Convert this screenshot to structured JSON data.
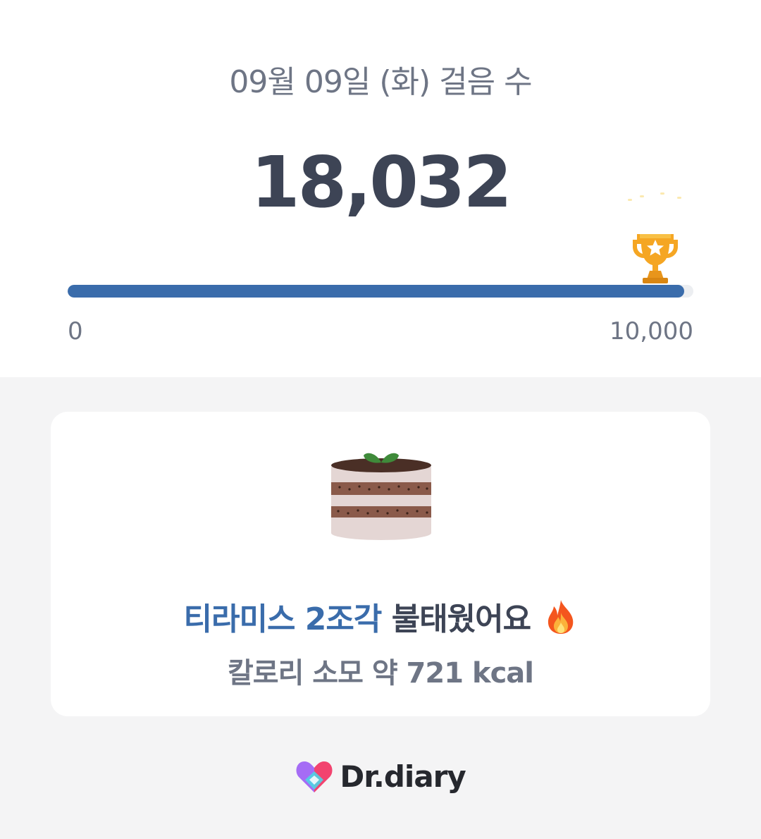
{
  "header": {
    "title": "09월 09일 (화) 걸음 수",
    "steps": "18,032"
  },
  "progress": {
    "min_label": "0",
    "max_label": "10,000",
    "fraction": 0.985,
    "fill_color": "#3a6cab",
    "goal_icon": "trophy-icon"
  },
  "card": {
    "food_icon": "tiramisu-cake-icon",
    "food_text": "티라미스 2조각",
    "burn_text": "불태웠어요",
    "fire_icon": "fire-icon",
    "calorie_text": "칼로리 소모 약 721 kcal"
  },
  "brand": {
    "name": "Dr.diary",
    "logo_icon": "heart-logo-icon"
  },
  "colors": {
    "accent": "#3a6cab",
    "primary_text": "#3d4455",
    "secondary_text": "#6e7585",
    "background": "#f4f4f5"
  }
}
